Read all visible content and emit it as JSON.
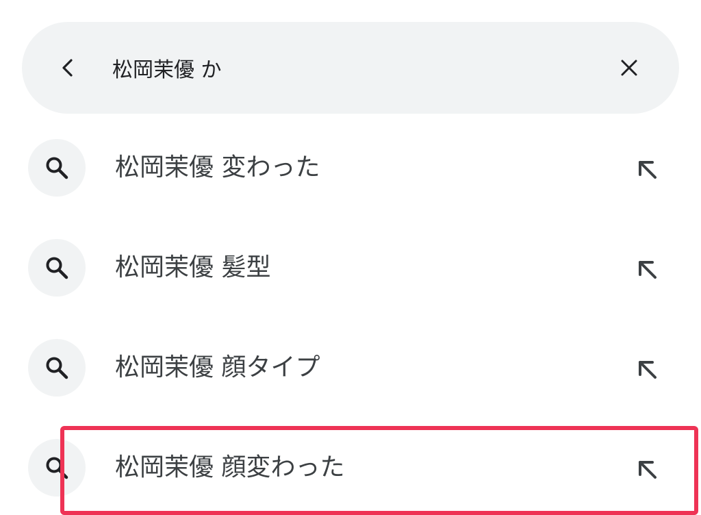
{
  "search": {
    "query": "松岡茉優 か",
    "back_icon": "arrow-back-icon",
    "clear_icon": "close-icon"
  },
  "suggestions": [
    {
      "label": "松岡茉優 変わった",
      "icon": "search-icon",
      "fill_icon": "arrow-up-left-icon"
    },
    {
      "label": "松岡茉優 髪型",
      "icon": "search-icon",
      "fill_icon": "arrow-up-left-icon"
    },
    {
      "label": "松岡茉優 顔タイプ",
      "icon": "search-icon",
      "fill_icon": "arrow-up-left-icon"
    },
    {
      "label": "松岡茉優 顔変わった",
      "icon": "search-icon",
      "fill_icon": "arrow-up-left-icon"
    }
  ],
  "colors": {
    "search_bar_bg": "#f1f3f4",
    "text": "#3c4043",
    "highlight": "#ee3355"
  }
}
